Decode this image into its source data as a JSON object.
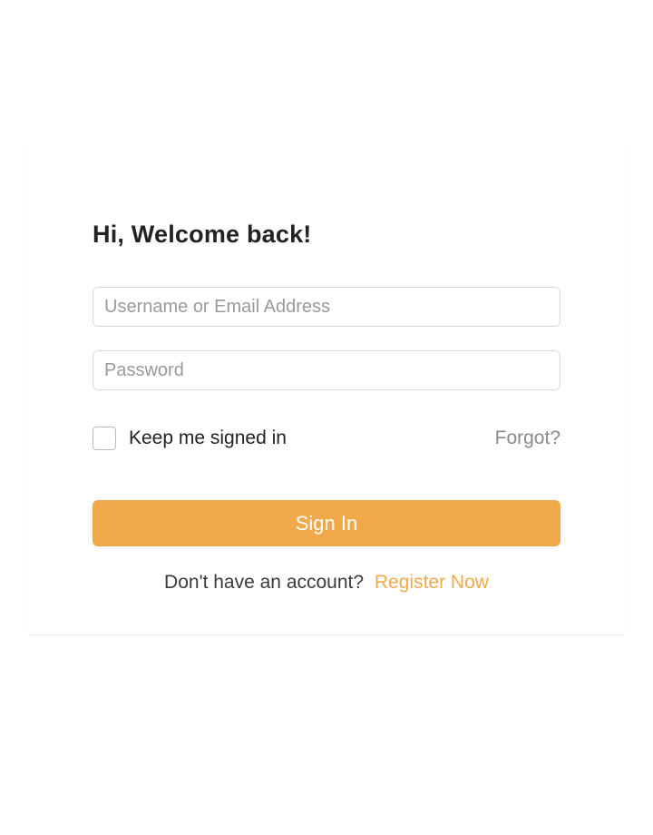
{
  "heading": "Hi, Welcome back!",
  "form": {
    "username_placeholder": "Username or Email Address",
    "password_placeholder": "Password",
    "keep_signed_in_label": "Keep me signed in",
    "forgot_label": "Forgot?",
    "submit_label": "Sign In"
  },
  "register": {
    "prompt": "Don't have an account?",
    "link_label": "Register Now"
  },
  "colors": {
    "accent": "#f0a94a"
  }
}
